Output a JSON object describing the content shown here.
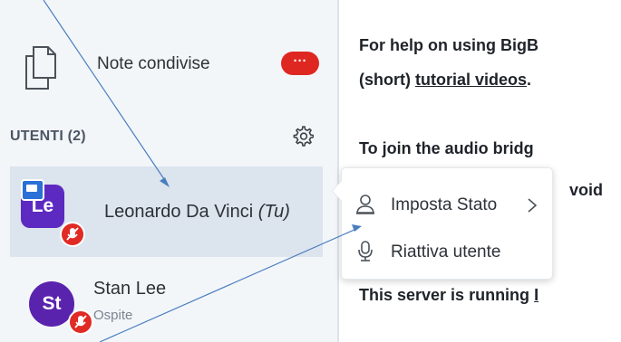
{
  "sidebar": {
    "shared_notes": {
      "label": "Note condivise",
      "badge": "···",
      "icon": "shared-notes-icon"
    },
    "users_header": "UTENTI (2)",
    "users": [
      {
        "initials": "Le",
        "name": "Leonardo Da Vinci",
        "suffix": "(Tu)",
        "role": "",
        "presenter": true,
        "muted": true,
        "avatar_color": "#5c2ac0"
      },
      {
        "initials": "St",
        "name": "Stan Lee",
        "suffix": "",
        "role": "Ospite",
        "presenter": false,
        "muted": true,
        "avatar_color": "#5a23ad"
      }
    ]
  },
  "main": {
    "line1": "For help on using BigB",
    "line2_prefix": "(short) ",
    "line2_link": "tutorial videos",
    "line2_suffix": ".",
    "line3": "To join the audio bridg",
    "line4": "void",
    "line5_text": "This server is running ",
    "line5_link": "I"
  },
  "context_menu": {
    "items": [
      {
        "label": "Imposta Stato",
        "icon": "user-status-icon",
        "has_submenu": true
      },
      {
        "label": "Riattiva utente",
        "icon": "microphone-icon",
        "has_submenu": false
      }
    ]
  },
  "colors": {
    "sidebar_bg": "#f3f6f9",
    "selected_row": "#dce4ee",
    "avatar": "#5c2ac0",
    "mute_badge": "#e02b24",
    "presenter_badge": "#2a70d6",
    "notes_badge": "#df2721",
    "annotation": "#4a7ec0"
  }
}
